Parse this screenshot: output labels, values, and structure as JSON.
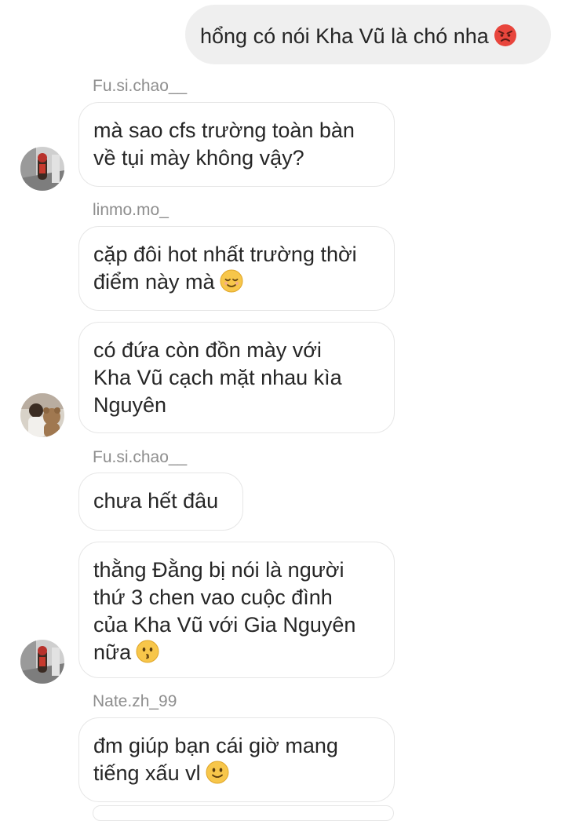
{
  "messages": {
    "outgoing_1": {
      "text": "hổng có nói Kha Vũ là chó nha",
      "emoji": "angry-face"
    },
    "group_1": {
      "sender": "Fu.si.chao__",
      "lines": [
        "mà sao cfs trường toàn bàn",
        "về tụi mày không vậy?"
      ]
    },
    "group_2": {
      "sender": "linmo.mo_",
      "msg1_lines": [
        "cặp đôi hot nhất trường thời",
        "điểm này mà"
      ],
      "msg1_emoji": "relieved-face",
      "msg2_lines": [
        "có đứa còn đồn mày với",
        "Kha Vũ cạch mặt nhau kìa",
        "Nguyên"
      ]
    },
    "group_3": {
      "sender": "Fu.si.chao__",
      "msg1_lines": [
        "chưa hết đâu"
      ],
      "msg2_lines": [
        "thằng Đằng bị nói là người",
        "thứ 3 chen vao cuộc đình",
        "của Kha Vũ với Gia Nguyên",
        "nữa"
      ],
      "msg2_emoji": "kissing-face"
    },
    "group_4": {
      "sender": "Nate.zh_99",
      "lines": [
        "đm giúp bạn cái giờ mang",
        "tiếng xấu vl"
      ],
      "emoji": "slightly-smiling-face"
    }
  },
  "colors": {
    "outgoing_bubble": "#efefef",
    "incoming_border": "#e6e6e6",
    "sender_text": "#8e8e8e",
    "text": "#262626"
  }
}
